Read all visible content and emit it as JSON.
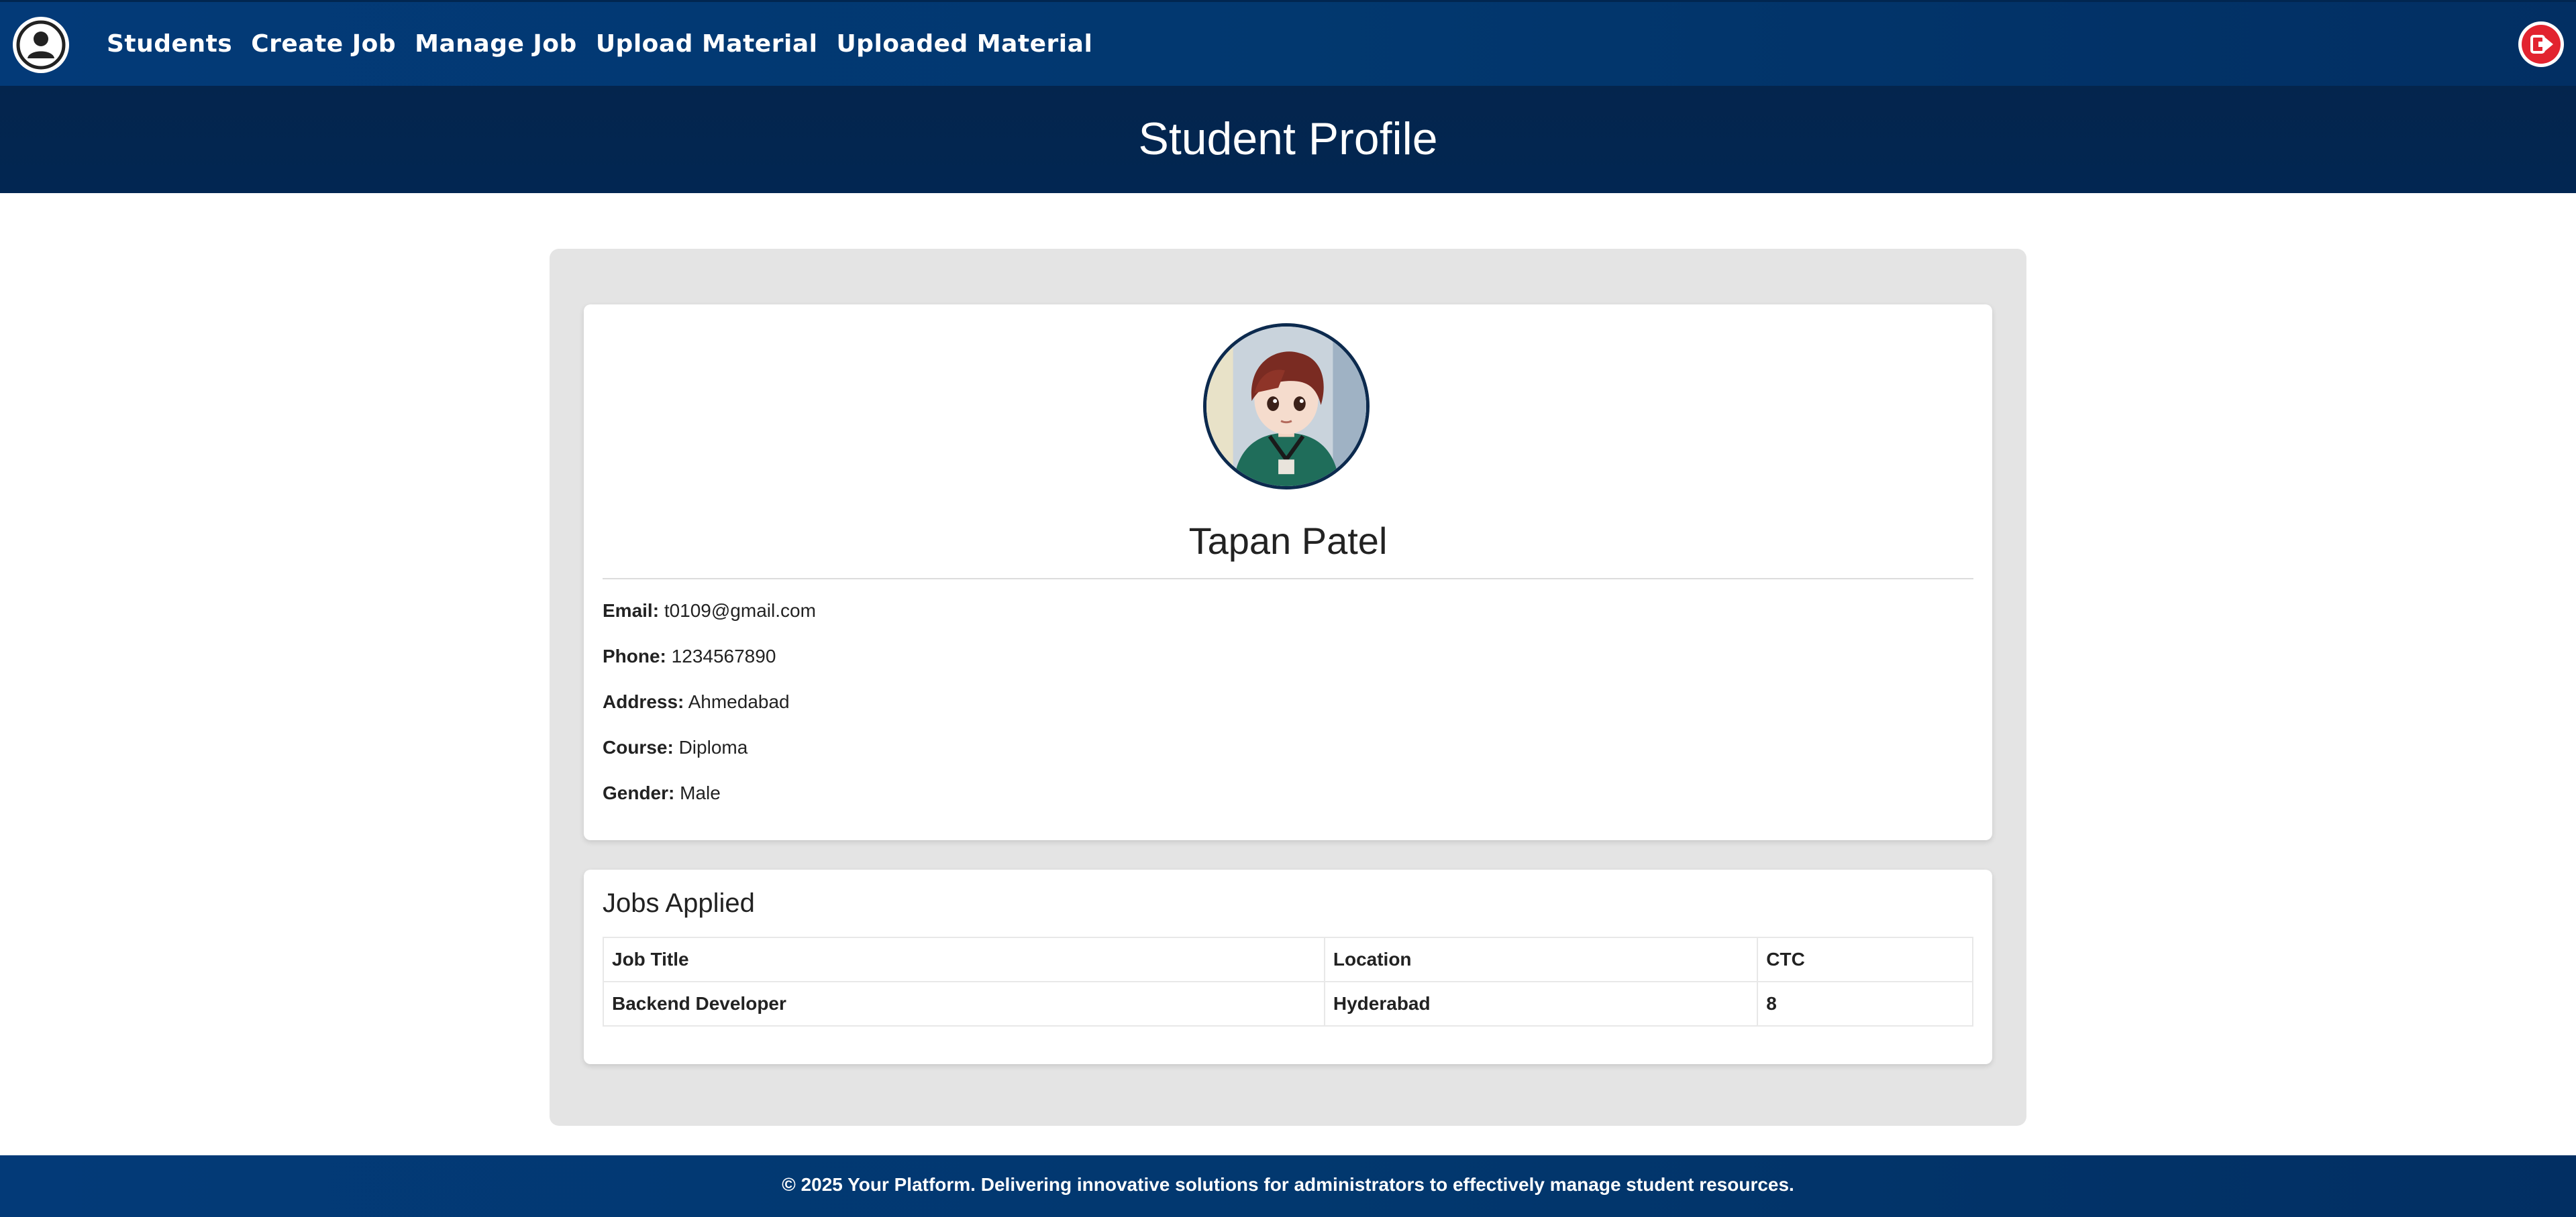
{
  "nav": {
    "items": [
      {
        "label": "Students"
      },
      {
        "label": "Create Job"
      },
      {
        "label": "Manage Job"
      },
      {
        "label": "Upload Material"
      },
      {
        "label": "Uploaded Material"
      }
    ],
    "logo_icon": "user-circle-icon",
    "logout_icon": "logout-icon"
  },
  "page": {
    "title": "Student Profile"
  },
  "profile": {
    "name": "Tapan Patel",
    "avatar_icon": "student-avatar",
    "fields": [
      {
        "label": "Email:",
        "value": "t0109@gmail.com"
      },
      {
        "label": "Phone:",
        "value": "1234567890"
      },
      {
        "label": "Address:",
        "value": "Ahmedabad"
      },
      {
        "label": "Course:",
        "value": "Diploma"
      },
      {
        "label": "Gender:",
        "value": "Male"
      }
    ]
  },
  "jobs": {
    "heading": "Jobs Applied",
    "columns": [
      "Job Title",
      "Location",
      "CTC"
    ],
    "rows": [
      [
        "Backend Developer",
        "Hyderabad",
        "8"
      ]
    ]
  },
  "footer": {
    "text": "© 2025 Your Platform. Delivering innovative solutions for administrators to effectively manage student resources."
  },
  "colors": {
    "nav_bg": "#033a78",
    "title_band_bg": "#04254d",
    "logout_red": "#e2232f",
    "panel_bg": "#e4e4e4"
  }
}
